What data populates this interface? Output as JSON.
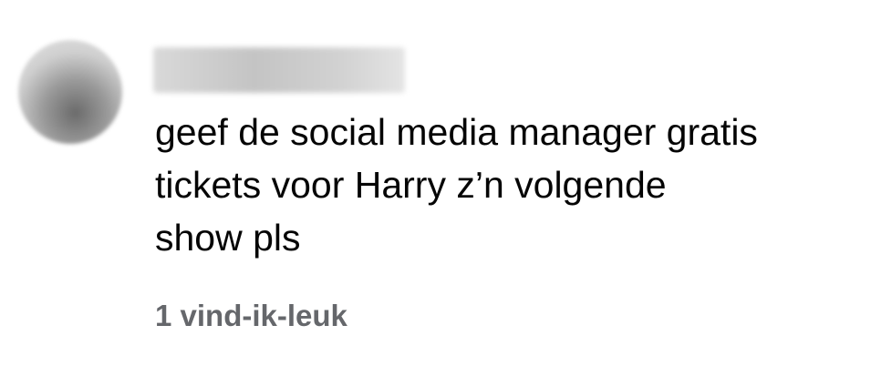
{
  "comment": {
    "text": "geef de social media manager gratis\ntickets voor Harry z’n volgende\nshow pls",
    "likes_label": "1 vind-ik-leuk"
  }
}
